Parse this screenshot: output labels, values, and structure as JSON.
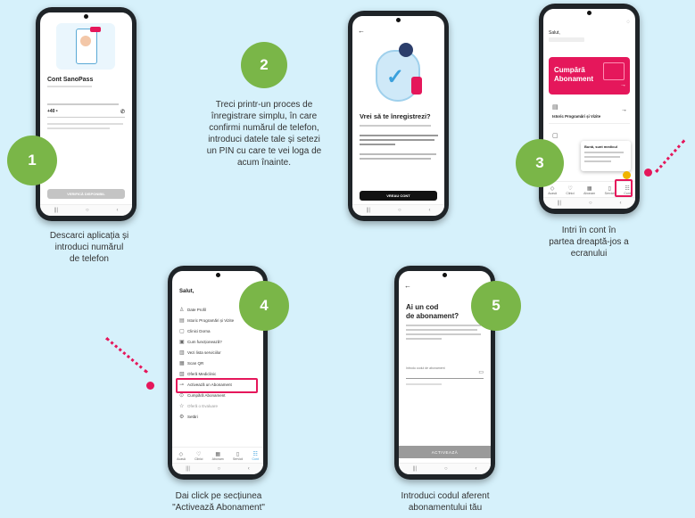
{
  "colors": {
    "background": "#d6f1fb",
    "step_circle": "#7ab648",
    "accent": "#e5175b",
    "phone_body": "#1f2428"
  },
  "steps": [
    {
      "number": "1",
      "caption_lines": [
        "Descarci aplicația și",
        "introduci numărul",
        "de telefon"
      ]
    },
    {
      "number": "2",
      "caption_lines": [
        "Treci printr-un proces de",
        "înregistrare simplu, în care",
        "confirmi numărul de telefon,",
        "introduci datele tale și setezi",
        "un PIN cu care te vei loga de",
        "acum înainte."
      ]
    },
    {
      "number": "3",
      "caption_lines": [
        "Intri în cont în",
        "partea dreaptă-jos a",
        "ecranului"
      ]
    },
    {
      "number": "4",
      "caption_lines": [
        "Dai click pe secțiunea",
        "\"Activează Abonament\""
      ]
    },
    {
      "number": "5",
      "caption_lines": [
        "Introduci codul aferent",
        "abonamentului tău"
      ]
    }
  ],
  "screen1": {
    "title": "Cont SanoPass",
    "phone_value": "+40 •",
    "button": "VERIFICĂ DISPONIBIL"
  },
  "screen2": {
    "title": "Vrei să te înregistrezi?",
    "button": "VREAU CONT"
  },
  "screen3": {
    "greeting": "Salut,",
    "card_title_1": "Cumpără",
    "card_title_2": "Abonament",
    "row_label": "Istoric Programări și Vizite",
    "popup_title": "Bună, sunt medicul",
    "tabs": [
      "Acasă",
      "Clinici",
      "Abonam",
      "Servicii",
      "Cont"
    ]
  },
  "screen4": {
    "greeting": "Salut,",
    "menu": [
      "Date Profil",
      "Istoric Programări și Vizite",
      "Clinici Dorna",
      "Cum funcționează?",
      "Vezi lista serviciilor",
      "Scan QR",
      "Oferă Mediclinic",
      "Activează un Abonament",
      "Cumpără Abonament",
      "Oferă o Evaluare",
      "Setări"
    ],
    "tabs": [
      "Acasă",
      "Clinici",
      "Abonam",
      "Servicii",
      "Cont"
    ]
  },
  "screen5": {
    "title_line1": "Ai un cod",
    "title_line2": "de abonament?",
    "input_label": "Introdu codul de abonament",
    "button": "ACTIVEAZĂ"
  }
}
